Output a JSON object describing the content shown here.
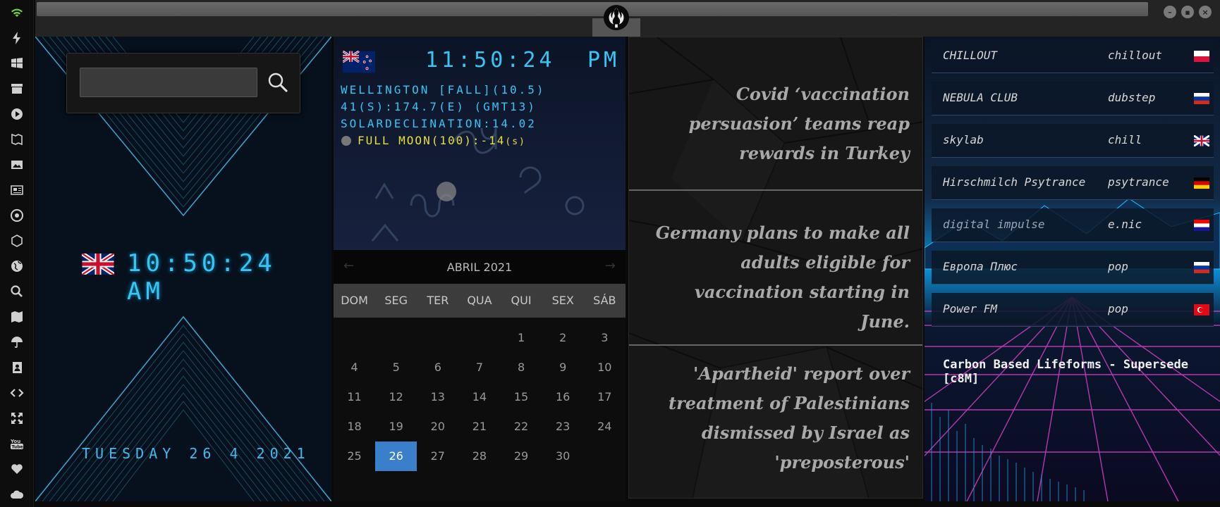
{
  "sidebar": {
    "icons": [
      "wifi-icon",
      "flash-icon",
      "windows-icon",
      "archive-icon",
      "play-icon",
      "map-book-icon",
      "image-icon",
      "news-icon",
      "settings-wheel-icon",
      "hexagon-icon",
      "globe-icon",
      "search-icon",
      "map-icon",
      "umbrella-icon",
      "contacts-icon",
      "code-icon",
      "fullscreen-icon",
      "youtube-icon",
      "heart-icon",
      "cloud-icon"
    ]
  },
  "uk_clock": {
    "time": "10:50:24 AM",
    "date": "TUESDAY 26 4 2021",
    "search_placeholder": ""
  },
  "nz_clock": {
    "time": "11:50:24",
    "ampm": "PM",
    "line1": "WELLINGTON [FALL](10.5)",
    "line2": "41(S):174.7(E) (GMT13)",
    "line3": "SOLARDECLINATION:14.02",
    "moon": "FULL MOON(100):-14",
    "moon_unit": "(s)"
  },
  "calendar": {
    "month": "ABRIL 2021",
    "prev": "←",
    "next": "→",
    "weekdays": [
      "DOM",
      "SEG",
      "TER",
      "QUA",
      "QUI",
      "SEX",
      "SÁB"
    ],
    "weeks": [
      [
        "",
        "",
        "",
        "",
        "1",
        "2",
        "3"
      ],
      [
        "4",
        "5",
        "6",
        "7",
        "8",
        "9",
        "10"
      ],
      [
        "11",
        "12",
        "13",
        "14",
        "15",
        "16",
        "17"
      ],
      [
        "18",
        "19",
        "20",
        "21",
        "22",
        "23",
        "24"
      ],
      [
        "25",
        "26",
        "27",
        "28",
        "29",
        "30",
        ""
      ]
    ],
    "today": "26"
  },
  "news": [
    "Covid ‘vaccination persuasion’ teams reap rewards in Turkey",
    "Germany plans to make all adults eligible for vaccination starting in June.",
    "'Apartheid' report over treatment of Palestinians dismissed by Israel as 'preposterous'"
  ],
  "radio": {
    "stations": [
      {
        "name": "CHILLOUT",
        "genre": "chillout",
        "flag": "pl"
      },
      {
        "name": "NEBULA CLUB",
        "genre": "dubstep",
        "flag": "ru"
      },
      {
        "name": "skylab",
        "genre": "chill",
        "flag": "gb"
      },
      {
        "name": "Hirschmilch Psytrance",
        "genre": "psytrance",
        "flag": "de"
      },
      {
        "name": "digital impulse",
        "genre": "e.nic",
        "flag": "hr"
      },
      {
        "name": "Европа Плюс",
        "genre": "pop",
        "flag": "ru"
      },
      {
        "name": "Power FM",
        "genre": "pop",
        "flag": "tr"
      }
    ],
    "now_playing": "Carbon Based Lifeforms - Supersede [c8M]"
  },
  "colors": {
    "accent": "#36c6f4",
    "moon_text": "#e6e03a",
    "today_bg": "#3a7fc9"
  }
}
